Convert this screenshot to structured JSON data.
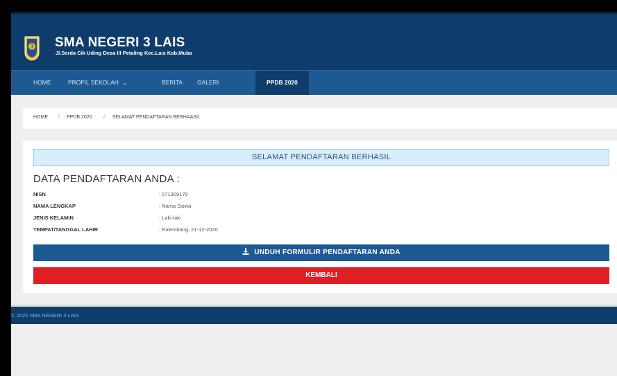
{
  "header": {
    "school_name": "SMA NEGERI 3 LAIS",
    "address": "Jl.Serda Cik Uding Desa III Petaling Kec.Lais Kab.Muba",
    "logo_text": "3"
  },
  "nav": {
    "items": [
      {
        "label": "HOME"
      },
      {
        "label": "PROFIL SEKOLAH"
      },
      {
        "label": "BERITA"
      },
      {
        "label": "GALERI"
      },
      {
        "label": "PPDB 2020"
      }
    ],
    "dropdown_glyph": "⌄"
  },
  "breadcrumb": {
    "items": [
      "HOME",
      "PPDB 2020",
      "SELAMAT PENDAFTARAN BERHAASIL"
    ],
    "separator": "/"
  },
  "main": {
    "success_message": "SELAMAT PENDAFTARAN BERHASIL",
    "section_title": "DATA PENDAFTARAN ANDA :",
    "fields": [
      {
        "label": "NISN",
        "value": ": 071309170"
      },
      {
        "label": "NAMA LENGKAP",
        "value": ": Nama Siswa"
      },
      {
        "label": "JENIS KELAMIN",
        "value": ": Laki-laki"
      },
      {
        "label": "TEMPAT/TANGGAL LAHIR",
        "value": ": Palembang, 21-12-2020"
      }
    ],
    "download_label": "UNDUH FORMULIR PENDAFTARAN ANDA",
    "back_label": "KEMBALI"
  },
  "footer": {
    "copyright": "© 2020 SMA NEGERI 3 LAIS"
  },
  "colors": {
    "header": "#0e3d6b",
    "navbar": "#1d5a93",
    "success_bg": "#d9eefb",
    "download_button": "#1d5a93",
    "back_button": "#e01f25"
  },
  "icons": [
    "school-logo",
    "download-icon",
    "chevron-down-icon"
  ]
}
